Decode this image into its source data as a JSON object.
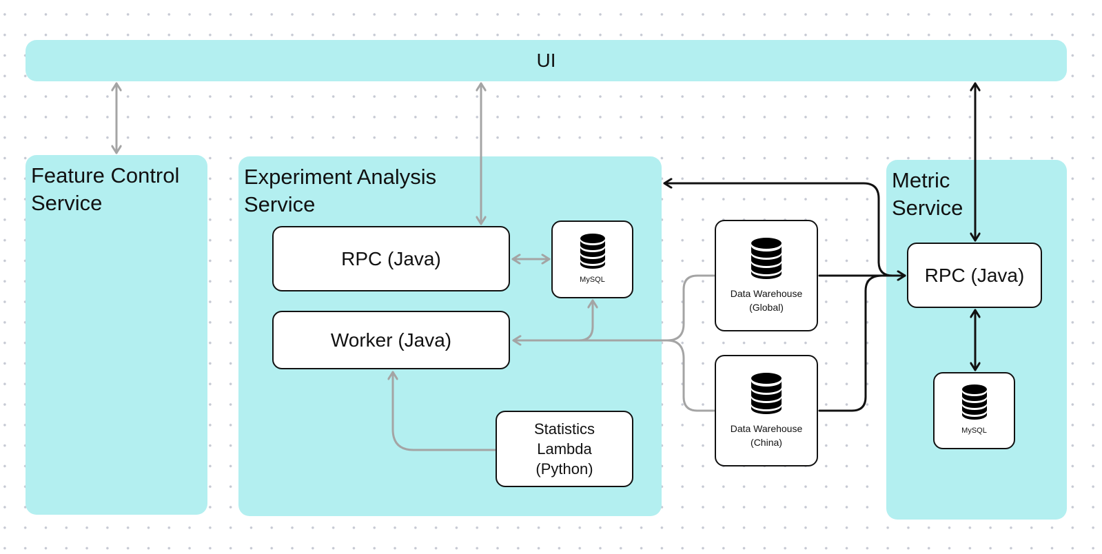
{
  "diagram": {
    "colors": {
      "region_fill": "#b3eff0",
      "box_fill": "#ffffff",
      "box_border": "#111111",
      "gray_connector": "#a4a4a4",
      "black_connector": "#111111"
    },
    "ui": {
      "label": "UI"
    },
    "feature_control_service": {
      "title": "Feature Control\nService"
    },
    "experiment_analysis_service": {
      "title": "Experiment Analysis\nService",
      "rpc": {
        "label": "RPC (Java)"
      },
      "worker": {
        "label": "Worker (Java)"
      },
      "mysql": {
        "label": "MySQL",
        "icon": "database-icon"
      },
      "statistics_lambda": {
        "label": "Statistics\nLambda\n(Python)"
      }
    },
    "data_warehouses": [
      {
        "label": "Data Warehouse\n(Global)",
        "icon": "database-icon"
      },
      {
        "label": "Data Warehouse\n(China)",
        "icon": "database-icon"
      }
    ],
    "metric_service": {
      "title": "Metric\nService",
      "rpc": {
        "label": "RPC (Java)"
      },
      "mysql": {
        "label": "MySQL",
        "icon": "database-icon"
      }
    },
    "connections": [
      {
        "from": "UI",
        "to": "Feature Control Service",
        "direction": "bidirectional",
        "style": "gray"
      },
      {
        "from": "UI",
        "to": "Experiment Analysis RPC (Java)",
        "direction": "bidirectional",
        "style": "gray"
      },
      {
        "from": "Experiment Analysis RPC (Java)",
        "to": "Experiment Analysis MySQL",
        "direction": "bidirectional",
        "style": "gray"
      },
      {
        "from": "Data Warehouse (Global)",
        "to": "Worker (Java)",
        "direction": "to-target",
        "style": "gray"
      },
      {
        "from": "Data Warehouse (China)",
        "to": "Worker (Java)",
        "direction": "to-target",
        "style": "gray"
      },
      {
        "from": "Worker (Java)",
        "to": "Experiment Analysis MySQL",
        "direction": "to-target",
        "style": "gray"
      },
      {
        "from": "Statistics Lambda (Python)",
        "to": "Worker (Java)",
        "direction": "to-target",
        "style": "gray"
      },
      {
        "from": "UI",
        "to": "Metric RPC (Java)",
        "direction": "bidirectional",
        "style": "black"
      },
      {
        "from": "Metric RPC (Java)",
        "to": "Experiment Analysis Service",
        "direction": "bidirectional",
        "style": "black"
      },
      {
        "from": "Data Warehouse (Global)",
        "to": "Metric RPC (Java)",
        "direction": "to-target",
        "style": "black"
      },
      {
        "from": "Data Warehouse (China)",
        "to": "Metric RPC (Java)",
        "direction": "to-target",
        "style": "black"
      },
      {
        "from": "Metric RPC (Java)",
        "to": "Metric MySQL",
        "direction": "bidirectional",
        "style": "black"
      }
    ]
  }
}
